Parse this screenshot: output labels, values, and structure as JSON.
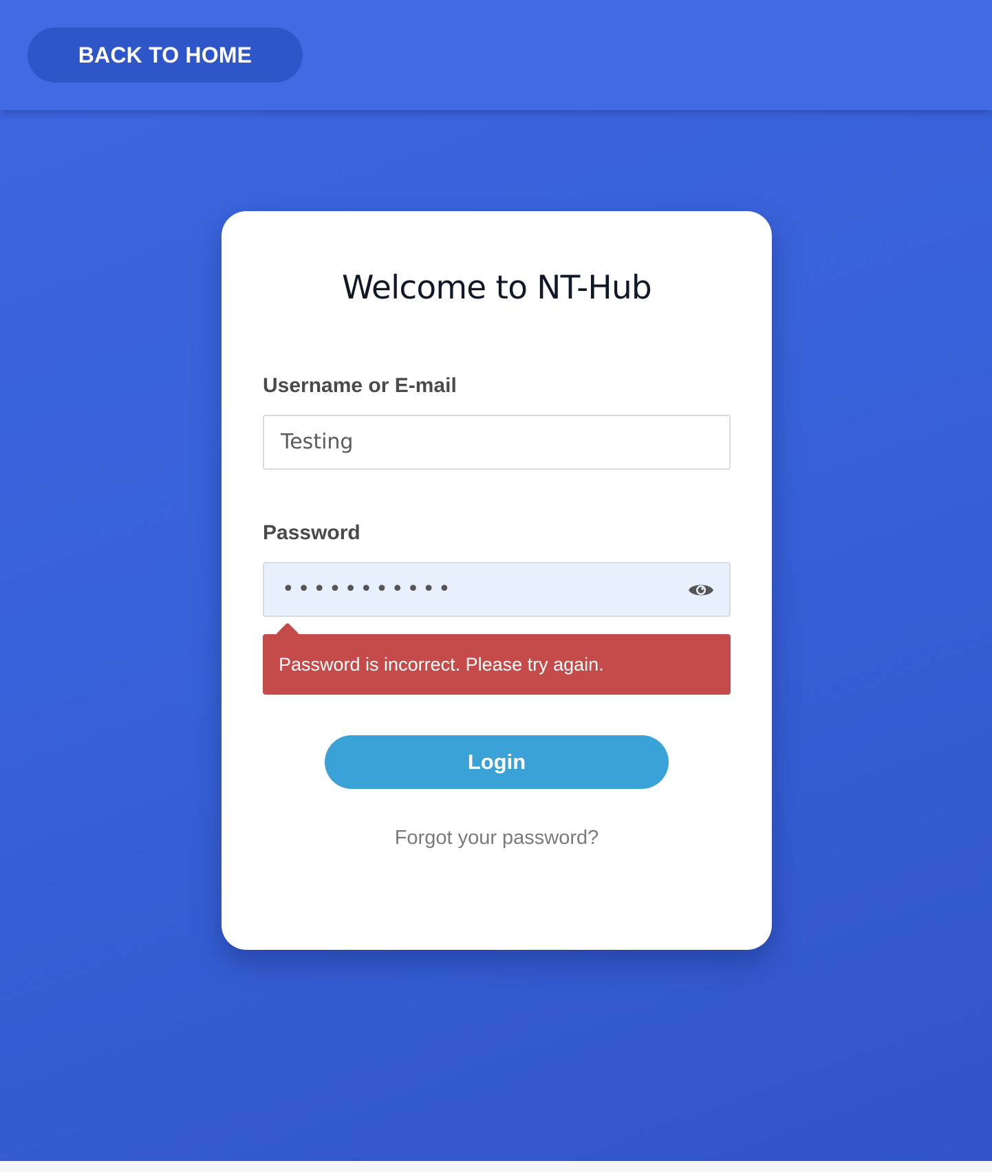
{
  "header": {
    "back_label": "BACK TO HOME"
  },
  "card": {
    "title": "Welcome to NT-Hub",
    "username": {
      "label": "Username or E-mail",
      "value": "Testing"
    },
    "password": {
      "label": "Password",
      "masked_value": "•••••••••••",
      "toggle_icon": "eye-icon"
    },
    "error_message": "Password is incorrect. Please try again.",
    "login_label": "Login",
    "forgot_label": "Forgot your password?"
  },
  "colors": {
    "background": "#3a62d8",
    "header": "#426ae2",
    "back_button": "#2f56c9",
    "login_button": "#3ba2d8",
    "error": "#c54b4b",
    "password_field": "#e8f0fd"
  }
}
